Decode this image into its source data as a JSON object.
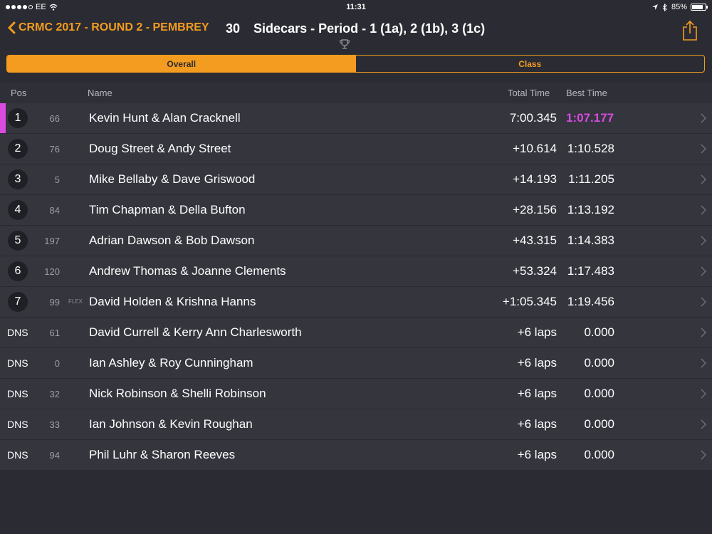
{
  "status_bar": {
    "carrier": "EE",
    "time": "11:31",
    "battery": "85%",
    "battery_level": 0.85
  },
  "nav": {
    "back_label": "CRMC 2017 - ROUND 2 - PEMBREY",
    "race_number": "30",
    "race_title": "Sidecars - Period - 1 (1a), 2 (1b), 3 (1c)"
  },
  "segments": {
    "overall": "Overall",
    "class": "Class"
  },
  "columns": {
    "pos": "Pos",
    "name": "Name",
    "total_time": "Total Time",
    "best_time": "Best Time"
  },
  "colors": {
    "accent": "#f39c1f",
    "fastest": "#d94be0"
  },
  "rows": [
    {
      "pos": "1",
      "bib": "66",
      "name": "Kevin Hunt & Alan Cracknell",
      "total": "7:00.345",
      "best": "1:07.177",
      "fastest": true
    },
    {
      "pos": "2",
      "bib": "76",
      "name": "Doug Street & Andy Street",
      "total": "+10.614",
      "best": "1:10.528"
    },
    {
      "pos": "3",
      "bib": "5",
      "name": "Mike Bellaby  & Dave Griswood",
      "total": "+14.193",
      "best": "1:11.205"
    },
    {
      "pos": "4",
      "bib": "84",
      "name": "Tim Chapman & Della Bufton",
      "total": "+28.156",
      "best": "1:13.192"
    },
    {
      "pos": "5",
      "bib": "197",
      "name": "Adrian Dawson & Bob Dawson",
      "total": "+43.315",
      "best": "1:14.383"
    },
    {
      "pos": "6",
      "bib": "120",
      "name": "Andrew Thomas & Joanne Clements",
      "total": "+53.324",
      "best": "1:17.483"
    },
    {
      "pos": "7",
      "bib": "99",
      "tag": "FLEX",
      "name": "David Holden & Krishna Hanns",
      "total": "+1:05.345",
      "best": "1:19.456"
    },
    {
      "pos": "DNS",
      "bib": "61",
      "name": "David Currell & Kerry Ann Charlesworth",
      "total": "+6 laps",
      "best": "0.000"
    },
    {
      "pos": "DNS",
      "bib": "0",
      "name": "Ian Ashley & Roy Cunningham",
      "total": "+6 laps",
      "best": "0.000"
    },
    {
      "pos": "DNS",
      "bib": "32",
      "name": "Nick Robinson  & Shelli Robinson",
      "total": "+6 laps",
      "best": "0.000"
    },
    {
      "pos": "DNS",
      "bib": "33",
      "name": "Ian Johnson & Kevin Roughan",
      "total": "+6 laps",
      "best": "0.000"
    },
    {
      "pos": "DNS",
      "bib": "94",
      "name": "Phil Luhr & Sharon Reeves",
      "total": "+6 laps",
      "best": "0.000"
    }
  ]
}
